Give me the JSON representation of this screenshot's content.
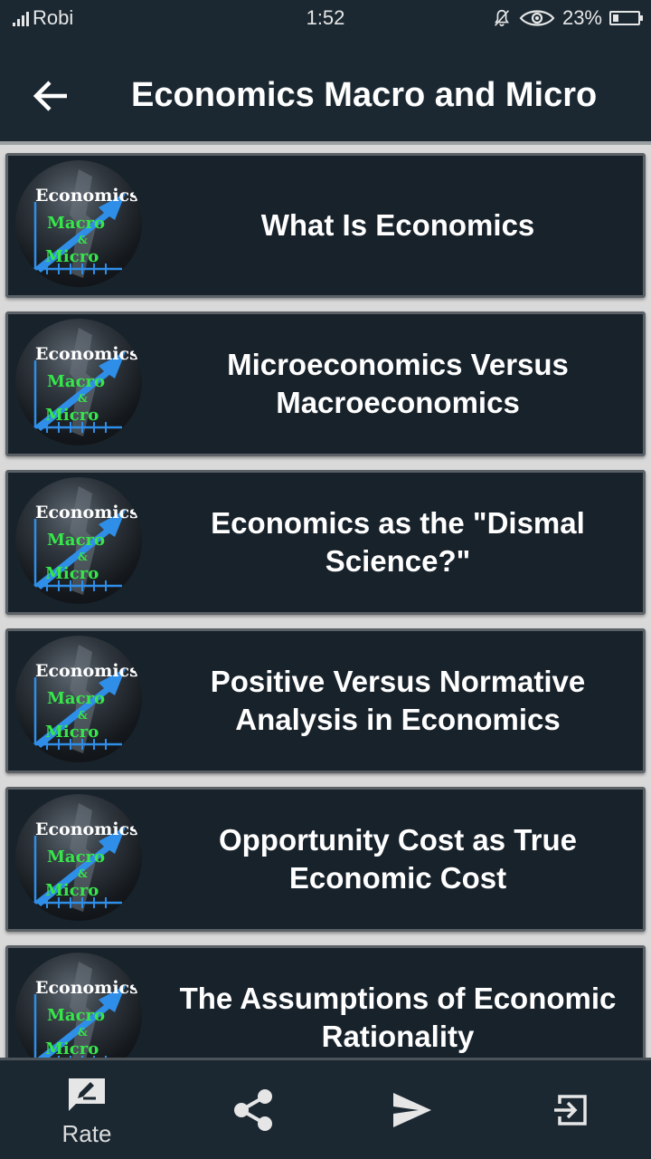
{
  "status_bar": {
    "carrier": "Robi",
    "time": "1:52",
    "battery": "23%",
    "battery_level": 0.23,
    "icons": [
      "signal-icon",
      "mute-bell-icon",
      "eye-icon",
      "battery-icon"
    ]
  },
  "app_bar": {
    "title": "Economics Macro and Micro",
    "back_icon": "back-arrow-icon"
  },
  "logo": {
    "line1": "Economics",
    "line2": "Macro",
    "line3": "&",
    "line4": "Micro"
  },
  "items": [
    {
      "title": "What Is Economics"
    },
    {
      "title": "Microeconomics Versus Macroeconomics"
    },
    {
      "title": "Economics as the \"Dismal Science?\""
    },
    {
      "title": "Positive Versus Normative Analysis in Economics"
    },
    {
      "title": "Opportunity Cost as True Economic Cost"
    },
    {
      "title": "The Assumptions of Economic Rationality"
    }
  ],
  "bottom_nav": [
    {
      "icon": "rate-icon",
      "label": "Rate"
    },
    {
      "icon": "share-icon",
      "label": ""
    },
    {
      "icon": "send-icon",
      "label": ""
    },
    {
      "icon": "exit-icon",
      "label": ""
    }
  ],
  "colors": {
    "bar_background": "#1b2832",
    "card_background": "#18222b",
    "page_background": "#d9d9d9",
    "logo_green": "#37e64b",
    "logo_arrow": "#2f8ee8"
  }
}
